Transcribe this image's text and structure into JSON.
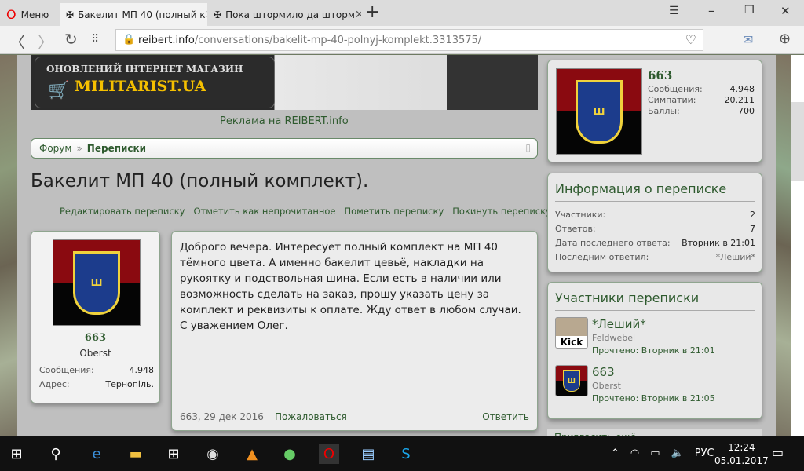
{
  "browser": {
    "menu": "Меню",
    "tabs": [
      {
        "title": "Бакелит МП 40 (полный к"
      },
      {
        "title": "Пока штормило да шторм"
      }
    ],
    "url_domain": "reibert.info",
    "url_path": "/conversations/bakelit-mp-40-polnyj-komplekt.3313575/"
  },
  "ad": {
    "line1": "ОНОВЛЕНИЙ ІНТЕРНЕТ МАГАЗИН",
    "line2": "MILITARIST.UA",
    "caption": "Реклама на REIBERT.info"
  },
  "breadcrumb": {
    "items": [
      "Форум",
      "Переписки"
    ],
    "sep": "»"
  },
  "title": "Бакелит МП 40 (полный комплект).",
  "actions": [
    "Редактировать переписку",
    "Отметить как непрочитанное",
    "Пометить переписку",
    "Покинуть переписку"
  ],
  "message": {
    "author": "663",
    "rank": "Oberst",
    "stats": [
      {
        "label": "Сообщения:",
        "value": "4.948"
      },
      {
        "label": "Адрес:",
        "value": "Тернопіль."
      }
    ],
    "text": "Доброго вечера. Интересует полный комплект на МП 40 тёмного цвета. А именно бакелит цевьё, накладки на рукоятку и подствольная шина. Если есть в наличии или возможность сделать на заказ, прошу указать цену за комплект и реквизиты к оплате. Жду ответ в любом случаи. С уважением Олег.",
    "meta": "663, 29 дек 2016",
    "report": "Пожаловаться",
    "reply": "Ответить"
  },
  "profile": {
    "name": "663",
    "stats": [
      {
        "label": "Сообщения:",
        "value": "4.948"
      },
      {
        "label": "Симпатии:",
        "value": "20.211"
      },
      {
        "label": "Баллы:",
        "value": "700"
      }
    ]
  },
  "info": {
    "title": "Информация о переписке",
    "rows": [
      {
        "label": "Участники:",
        "value": "2"
      },
      {
        "label": "Ответов:",
        "value": "7"
      },
      {
        "label": "Дата последнего ответа:",
        "value": "Вторник в 21:01"
      },
      {
        "label": "Последним ответил:",
        "value": "*Леший*"
      }
    ]
  },
  "participants": {
    "title": "Участники переписки",
    "items": [
      {
        "name": "*Леший*",
        "rank": "Feldwebel",
        "read": "Прочтено: Вторник в 21:01",
        "avatar_text": "Kick"
      },
      {
        "name": "663",
        "rank": "Oberst",
        "read": "Прочтено: Вторник в 21:05"
      }
    ],
    "invite": "Пригласить ещё"
  },
  "taskbar": {
    "lang": "РУС",
    "time": "12:24",
    "date": "05.01.2017"
  }
}
